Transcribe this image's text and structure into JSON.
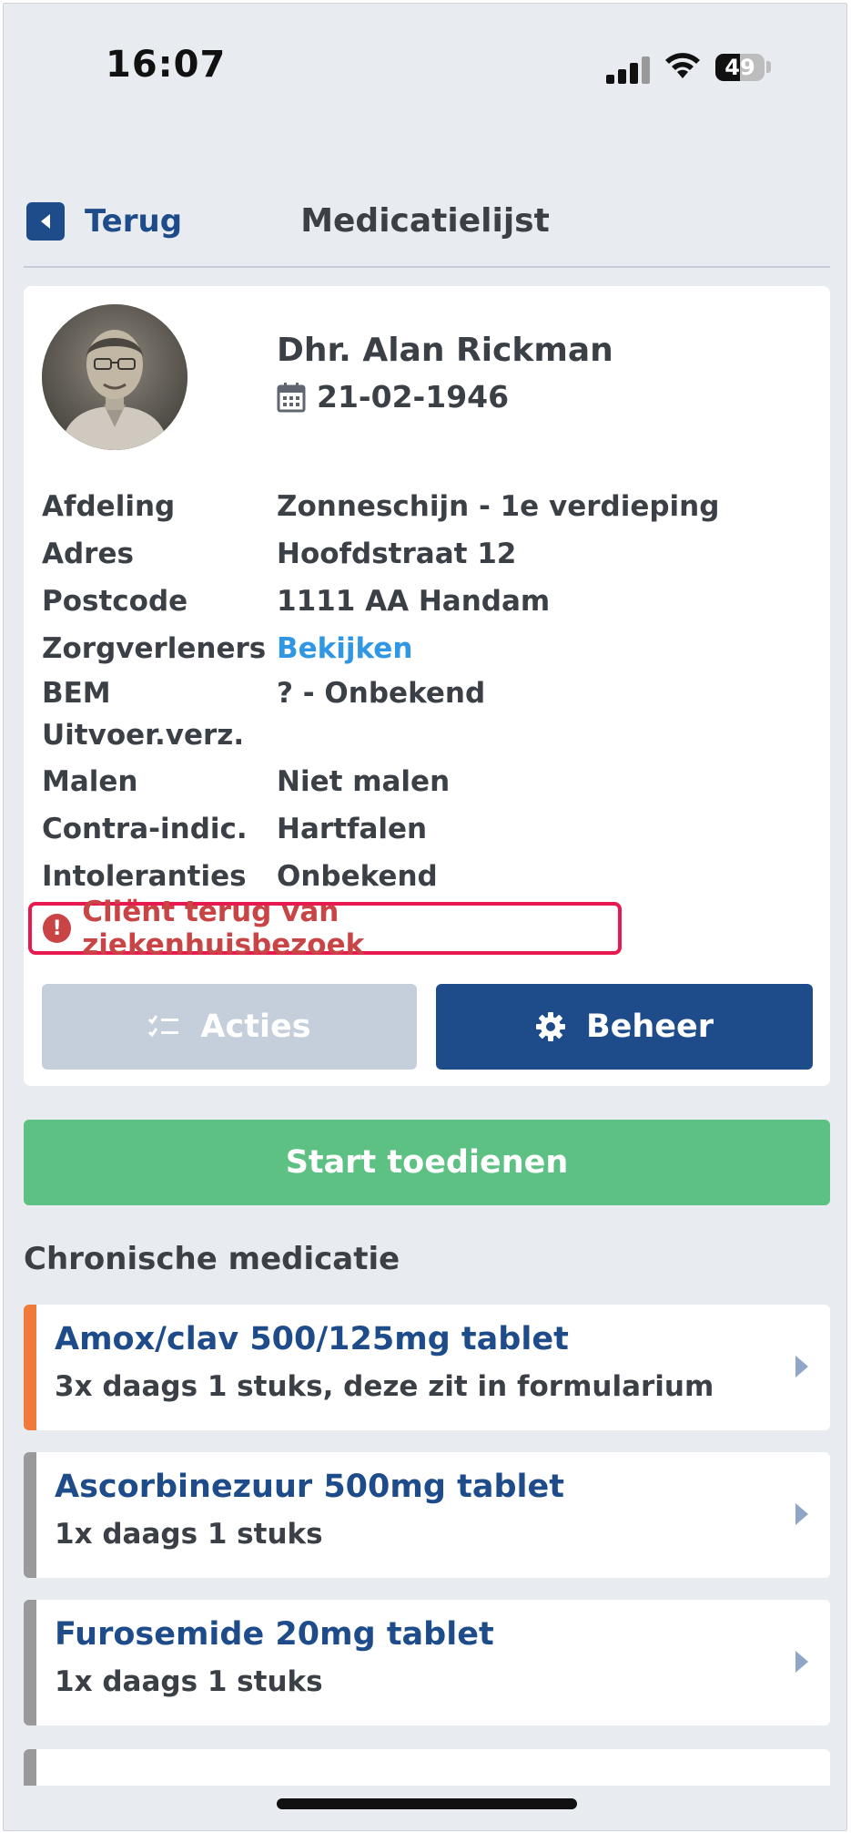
{
  "status_bar": {
    "time": "16:07",
    "battery": "49"
  },
  "header": {
    "back_label": "Terug",
    "title": "Medicatielijst"
  },
  "client": {
    "name": "Dhr. Alan Rickman",
    "birth_date": "21-02-1946",
    "fields": [
      {
        "label": "Afdeling",
        "value": "Zonneschijn - 1e verdieping"
      },
      {
        "label": "Adres",
        "value": "Hoofdstraat 12"
      },
      {
        "label": "Postcode",
        "value": "1111 AA Handam"
      },
      {
        "label": "Zorgverleners",
        "value": "Bekijken"
      },
      {
        "label": "BEM Uitvoer.verz.",
        "value": "? - Onbekend"
      },
      {
        "label": "Malen",
        "value": "Niet malen"
      },
      {
        "label": "Contra-indic.",
        "value": "Hartfalen"
      },
      {
        "label": "Intoleranties",
        "value": "Onbekend"
      }
    ],
    "alert": "Cliënt terug van ziekenhuisbezoek"
  },
  "buttons": {
    "acties": "Acties",
    "beheer": "Beheer",
    "start": "Start toedienen"
  },
  "section_title": "Chronische medicatie",
  "medications": [
    {
      "name": "Amox/clav 500/125mg tablet",
      "dose": "3x daags 1 stuks, deze zit in formularium",
      "color": "#f07a3a"
    },
    {
      "name": "Ascorbinezuur 500mg tablet",
      "dose": "1x daags 1 stuks",
      "color": "#9a9a9a"
    },
    {
      "name": "Furosemide 20mg tablet",
      "dose": "1x daags 1 stuks",
      "color": "#9a9a9a"
    }
  ],
  "colors": {
    "primary": "#1e4c8a",
    "success": "#5cc182",
    "alert": "#c94444",
    "link": "#2f97e3"
  }
}
